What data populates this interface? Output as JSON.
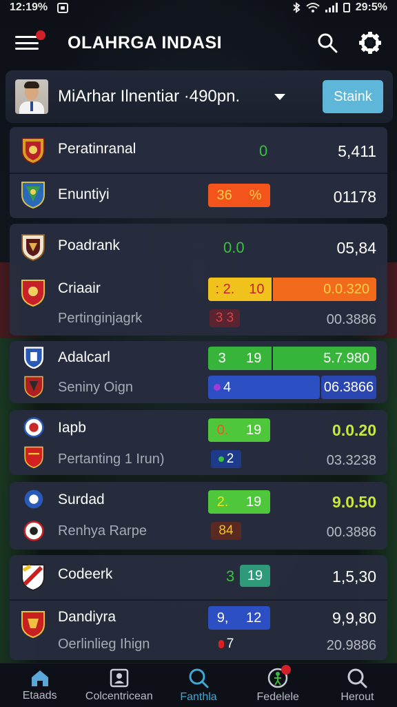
{
  "status_bar": {
    "time": "12:19%",
    "clock": "29:5%"
  },
  "header": {
    "title": "OLAHRGA INDASI"
  },
  "user": {
    "name": "MiArhar Ilnentiar ·490pn.",
    "button_label": "Staink"
  },
  "colors": {
    "accent": "#5eb6d8",
    "orange": "#f2541c",
    "green": "#3db83a",
    "blue": "#2d56c8",
    "yellow": "#f0c020",
    "lime": "#c8e83a",
    "notification": "#d0202a"
  },
  "rows": [
    {
      "name": "Peratinranal",
      "score": "0",
      "value": "5,411"
    },
    {
      "name": "Enuntiyi",
      "pill_left": "36",
      "pill_right": "%",
      "value": "01178"
    },
    {
      "name": "Poadrank",
      "score": "0.0",
      "value": "05,84"
    },
    {
      "name": "Criaair",
      "sub": "Pertinginjagrk",
      "pill_a": ": 2.",
      "pill_b": "10",
      "pill_value": "0.0.320",
      "small": "3 3",
      "value2": "00.3886"
    },
    {
      "name": "Adalcarl",
      "sub": "Seniny Oign",
      "pill_a": "3",
      "pill_b": "19",
      "pill_value": "5.7.980",
      "small": "4",
      "value2": "06.3866"
    },
    {
      "name": "Iapb",
      "sub": "Pertanting 1 Irun)",
      "pill_a": "0.",
      "pill_b": "19",
      "value": "0.0.20",
      "small": "2",
      "value2": "03.3238"
    },
    {
      "name": "Surdad",
      "sub": "Renhya Rarpe",
      "pill_a": "2.",
      "pill_b": "19",
      "value": "9.0.50",
      "small": "84",
      "value2": "00.3886"
    },
    {
      "name": "Codeerk",
      "score": "3",
      "pill_b": "19",
      "value": "1,5,30"
    },
    {
      "name": "Dandiyra",
      "sub": "Oerlinlieg Ihign",
      "pill_a": "9,",
      "pill_b": "12",
      "value": "9,9,80",
      "small": "7",
      "value2": "20.9886"
    }
  ],
  "nav": [
    {
      "label": "Etaads",
      "icon": "home-icon"
    },
    {
      "label": "Colcentricean",
      "icon": "profile-card-icon"
    },
    {
      "label": "Fanthla",
      "icon": "search-icon"
    },
    {
      "label": "Fedelele",
      "icon": "player-icon"
    },
    {
      "label": "Herout",
      "icon": "search-icon"
    }
  ]
}
